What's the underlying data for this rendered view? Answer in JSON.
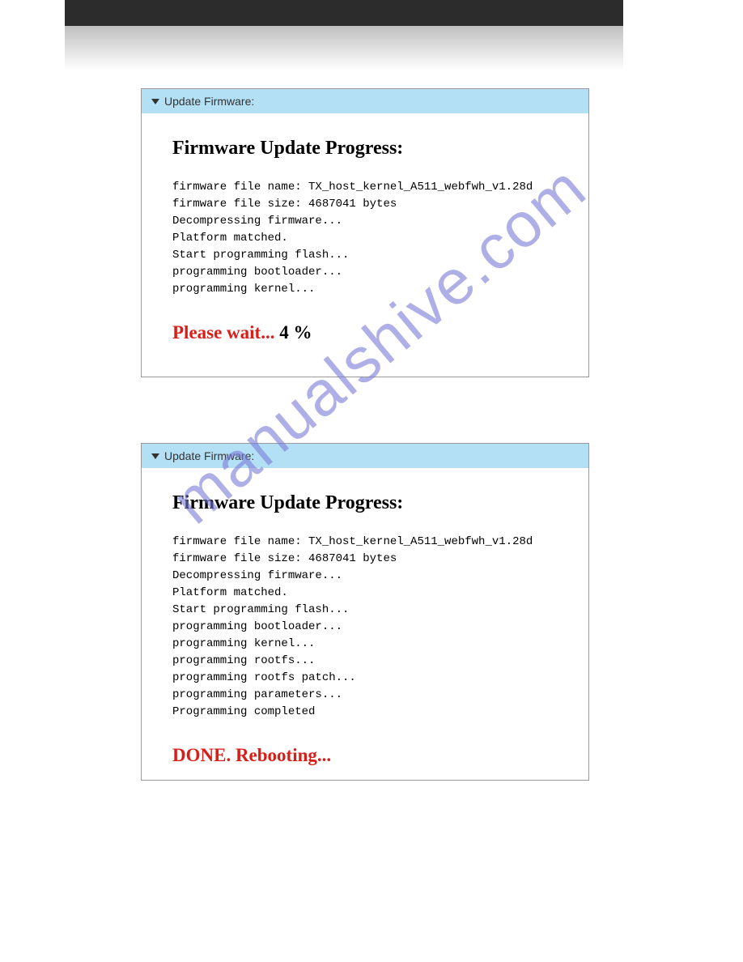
{
  "watermark": "manualshive.com",
  "panel1": {
    "header": "Update Firmware:",
    "title": "Firmware Update Progress:",
    "log_lines": [
      "firmware file name: TX_host_kernel_A511_webfwh_v1.28d",
      "firmware file size: 4687041 bytes",
      "Decompressing firmware...",
      "Platform matched.",
      "Start programming flash...",
      "programming bootloader...",
      "programming kernel..."
    ],
    "status_red": "Please wait... ",
    "status_black": "4 %"
  },
  "panel2": {
    "header": "Update Firmware:",
    "title": "Firmware Update Progress:",
    "log_lines": [
      "firmware file name: TX_host_kernel_A511_webfwh_v1.28d",
      "firmware file size: 4687041 bytes",
      "Decompressing firmware...",
      "Platform matched.",
      "Start programming flash...",
      "programming bootloader...",
      "programming kernel...",
      "programming rootfs...",
      "programming rootfs patch...",
      "programming parameters...",
      "Programming completed"
    ],
    "status_red": "DONE. Rebooting...",
    "status_black": ""
  }
}
